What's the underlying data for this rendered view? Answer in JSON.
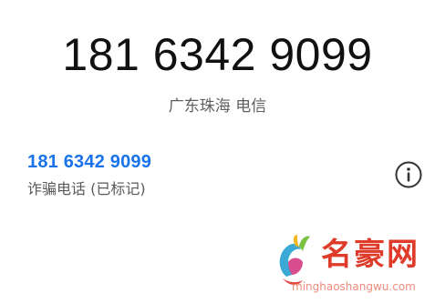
{
  "caller": {
    "number": "181 6342 9099",
    "location": "广东珠海 电信"
  },
  "entry": {
    "number": "181 6342 9099",
    "tag": "诈骗电话 (已标记)",
    "info_icon": "info-circle-icon"
  },
  "watermark": {
    "brand": "名豪网",
    "url": "minghaoshangwu.com"
  },
  "colors": {
    "accent": "#1a73e8",
    "primary_text": "#111111",
    "secondary_text": "#5f5f5f",
    "watermark_red": "#df3b2a"
  }
}
